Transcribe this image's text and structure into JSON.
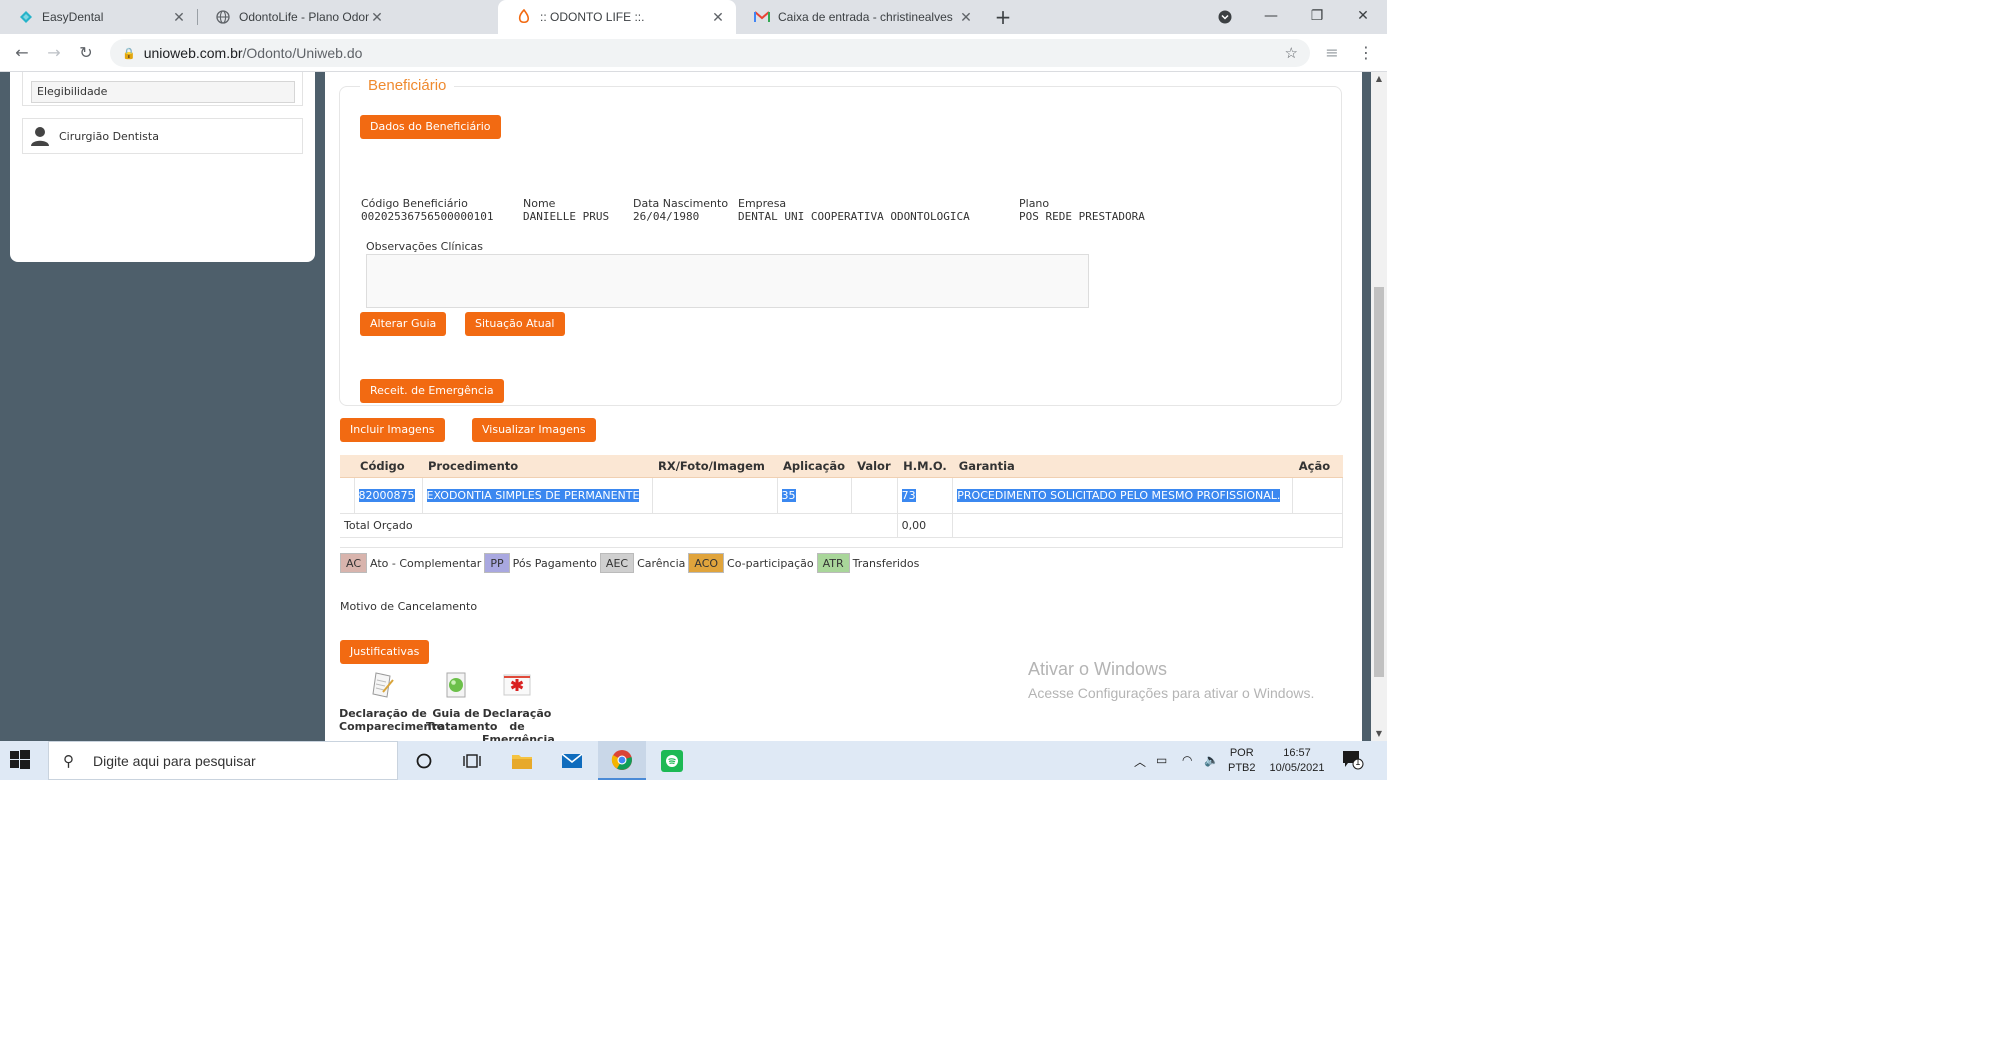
{
  "browser": {
    "tabs": [
      {
        "label": "EasyDental",
        "active": false
      },
      {
        "label": "OdontoLife - Plano Odontológico",
        "active": false
      },
      {
        "label": ":: ODONTO LIFE ::.",
        "active": true
      },
      {
        "label": "Caixa de entrada - christinealves",
        "active": false
      }
    ],
    "url_domain": "unioweb.com.br",
    "url_path": "/Odonto/Uniweb.do"
  },
  "sidebar": {
    "elegibilidade": "Elegibilidade",
    "dentista": "Cirurgião Dentista"
  },
  "beneficiario": {
    "legend": "Beneficiário",
    "dados_button": "Dados do Beneficiário",
    "fields": [
      {
        "label": "Código Beneficiário",
        "value": "00202536756500000101"
      },
      {
        "label": "Nome",
        "value": "DANIELLE PRUS"
      },
      {
        "label": "Data Nascimento",
        "value": "26/04/1980"
      },
      {
        "label": "Empresa",
        "value": "DENTAL UNI COOPERATIVA ODONTOLOGICA"
      },
      {
        "label": "Plano",
        "value": "POS REDE PRESTADORA"
      }
    ],
    "obs_label": "Observações Clínicas",
    "alterar_button": "Alterar Guia",
    "situacao_button": "Situação Atual",
    "receit_button": "Receit. de Emergência"
  },
  "images": {
    "incluir_button": "Incluir Imagens",
    "visualizar_button": "Visualizar Imagens"
  },
  "table": {
    "headers": [
      "Código",
      "Procedimento",
      "RX/Foto/Imagem",
      "Aplicação",
      "Valor",
      "H.M.O.",
      "Garantia",
      "Ação"
    ],
    "row": {
      "codigo": "82000875",
      "procedimento": "EXODONTIA SIMPLES DE PERMANENTE",
      "rx": "",
      "aplicacao": "35",
      "valor": "",
      "hmo": "73",
      "garantia": "PROCEDIMENTO SOLICITADO PELO MESMO PROFISSIONAL.",
      "acao": ""
    },
    "total_label": "Total Orçado",
    "total_value": "0,00"
  },
  "legend": [
    {
      "code": "AC",
      "label": "Ato - Complementar",
      "color": "#d8b4ad"
    },
    {
      "code": "PP",
      "label": "Pós Pagamento",
      "color": "#a9a8e0"
    },
    {
      "code": "AEC",
      "label": "Carência",
      "color": "#cfcfcf"
    },
    {
      "code": "ACO",
      "label": "Co-participação",
      "color": "#e0a43c"
    },
    {
      "code": "ATR",
      "label": "Transferidos",
      "color": "#a9d69a"
    }
  ],
  "motivo_label": "Motivo de Cancelamento",
  "justificativas_button": "Justificativas",
  "documents": [
    {
      "label": "Declaração de Comparecimento",
      "icon": "document-icon"
    },
    {
      "label": "Guia de Tratamento",
      "icon": "green-ball-icon"
    },
    {
      "label": "Declaração de Emergência",
      "icon": "emergency-icon"
    }
  ],
  "watermark": {
    "title": "Ativar o Windows",
    "subtitle": "Acesse Configurações para ativar o Windows."
  },
  "taskbar": {
    "search_placeholder": "Digite aqui para pesquisar",
    "lang_top": "POR",
    "lang_bottom": "PTB2",
    "time": "16:57",
    "date": "10/05/2021",
    "notif_count": "1"
  },
  "colors": {
    "accent": "#f26a12",
    "legend_orange": "#ef8a2f",
    "selection": "#3b88f0",
    "page_bg": "#4e5f6b"
  }
}
